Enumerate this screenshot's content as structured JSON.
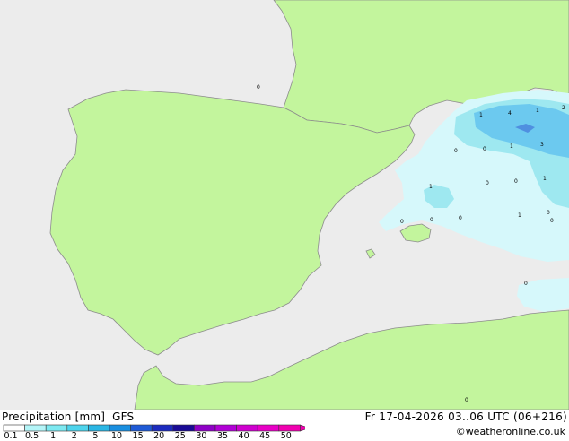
{
  "title": "Precipitation [mm]",
  "model": "GFS",
  "valid_time": "Fr 17-04-2026 03..06 UTC (06+216)",
  "credit": "©weatheronline.co.uk",
  "colors": {
    "sea": "#ececec",
    "land": "#c3f59d",
    "coast": "#8c8c8c",
    "border": "#9a9a9a",
    "precip_light": "#d6f8fb",
    "precip_mid": "#9ee8f0",
    "precip_heavy": "#6cc9ef",
    "precip_core": "#4f8fe0"
  },
  "scale": {
    "ticks": [
      "0.1",
      "0.5",
      "1",
      "2",
      "5",
      "10",
      "15",
      "20",
      "25",
      "30",
      "35",
      "40",
      "45",
      "50"
    ],
    "colors": [
      "#ffffff",
      "#b4f5f8",
      "#7de9f1",
      "#4ed4ec",
      "#2bb6e4",
      "#1a8fe0",
      "#1f5ad6",
      "#1c2bbf",
      "#1a0b96",
      "#8f00c7",
      "#b100d6",
      "#cf00cf",
      "#e800c6",
      "#f000b0"
    ]
  },
  "precip_values": [
    "0",
    "1",
    "4",
    "1",
    "2",
    "0",
    "0",
    "1",
    "3",
    "1",
    "0",
    "0",
    "1",
    "1",
    "0",
    "0",
    "0",
    "0",
    "0",
    "0",
    "0"
  ]
}
